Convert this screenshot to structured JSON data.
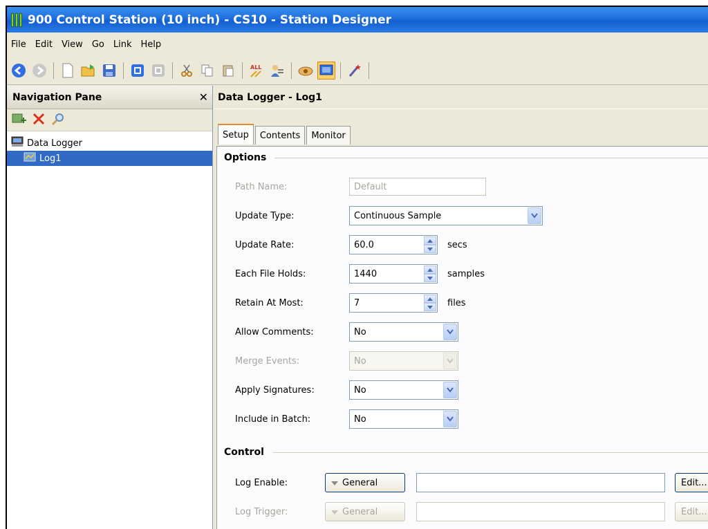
{
  "window": {
    "title": "900 Control Station (10 inch) - CS10 - Station Designer"
  },
  "menu": [
    "File",
    "Edit",
    "View",
    "Go",
    "Link",
    "Help"
  ],
  "toolbar": {
    "icons": [
      "back-icon",
      "forward-icon",
      "new-icon",
      "open-icon",
      "save-icon",
      "download-icon",
      "upload-icon",
      "cut-icon",
      "copy-icon",
      "paste-icon",
      "find-all-icon",
      "rename-icon",
      "link-icon",
      "display-icon",
      "wand-icon"
    ]
  },
  "nav": {
    "title": "Navigation Pane",
    "close": "✕",
    "tree": [
      {
        "label": "Data Logger"
      },
      {
        "label": "Log1"
      }
    ]
  },
  "content": {
    "title": "Data Logger - Log1",
    "tabs": [
      "Setup",
      "Contents",
      "Monitor"
    ],
    "options": {
      "title": "Options",
      "path_name": {
        "label": "Path Name:",
        "value": "Default"
      },
      "update_type": {
        "label": "Update Type:",
        "value": "Continuous Sample"
      },
      "update_rate": {
        "label": "Update Rate:",
        "value": "60.0",
        "unit": "secs"
      },
      "file_holds": {
        "label": "Each File Holds:",
        "value": "1440",
        "unit": "samples"
      },
      "retain": {
        "label": "Retain At Most:",
        "value": "7",
        "unit": "files"
      },
      "allow_comments": {
        "label": "Allow Comments:",
        "value": "No"
      },
      "merge_events": {
        "label": "Merge Events:",
        "value": "No"
      },
      "apply_signatures": {
        "label": "Apply Signatures:",
        "value": "No"
      },
      "include_batch": {
        "label": "Include in Batch:",
        "value": "No"
      }
    },
    "control": {
      "title": "Control",
      "log_enable": {
        "label": "Log Enable:",
        "tag": "General",
        "value": "",
        "edit": "Edit..."
      },
      "log_trigger": {
        "label": "Log Trigger:",
        "tag": "General",
        "value": "",
        "edit": "Edit..."
      }
    }
  }
}
